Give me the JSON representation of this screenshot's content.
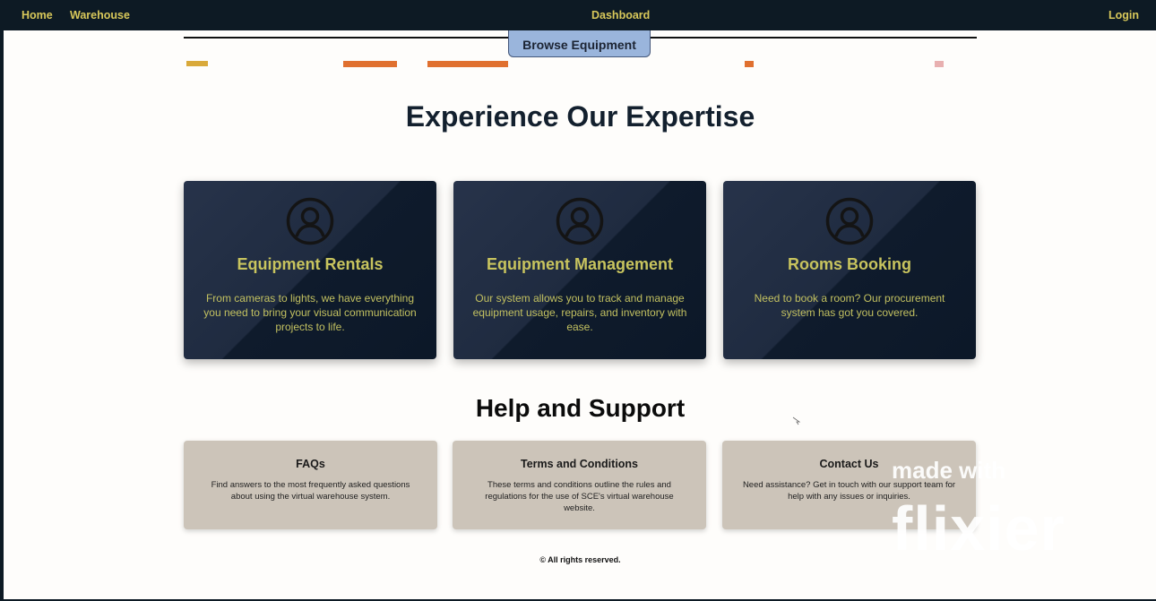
{
  "nav": {
    "home": "Home",
    "warehouse": "Warehouse",
    "dashboard": "Dashboard",
    "login": "Login"
  },
  "hero": {
    "browse_button": "Browse Equipment"
  },
  "expertise": {
    "title": "Experience Our Expertise",
    "cards": [
      {
        "icon": "user-circle-icon",
        "title": "Equipment Rentals",
        "description": "From cameras to lights, we have everything you need to bring your visual communication projects to life."
      },
      {
        "icon": "user-circle-icon",
        "title": "Equipment Management",
        "description": "Our system allows you to track and manage equipment usage, repairs, and inventory with ease."
      },
      {
        "icon": "user-circle-icon",
        "title": "Rooms Booking",
        "description": "Need to book a room? Our procurement system has got you covered."
      }
    ]
  },
  "support": {
    "title": "Help and Support",
    "cards": [
      {
        "title": "FAQs",
        "description": "Find answers to the most frequently asked questions about using the virtual warehouse system."
      },
      {
        "title": "Terms and Conditions",
        "description": "These terms and conditions outline the rules and regulations for the use of SCE's virtual warehouse website."
      },
      {
        "title": "Contact Us",
        "description": "Need assistance? Get in touch with our support team for help with any issues or inquiries."
      }
    ]
  },
  "footer": {
    "text": "© All rights reserved."
  },
  "watermark": {
    "line1": "made with",
    "brand": "flixier"
  },
  "colors": {
    "navbar_bg": "#0d1a24",
    "nav_link": "#d8c85a",
    "card_bg": "#1b2638",
    "card_text": "#c8c45e",
    "help_card_bg": "#ccc4b9",
    "browse_button_bg": "#9ab5dc"
  }
}
